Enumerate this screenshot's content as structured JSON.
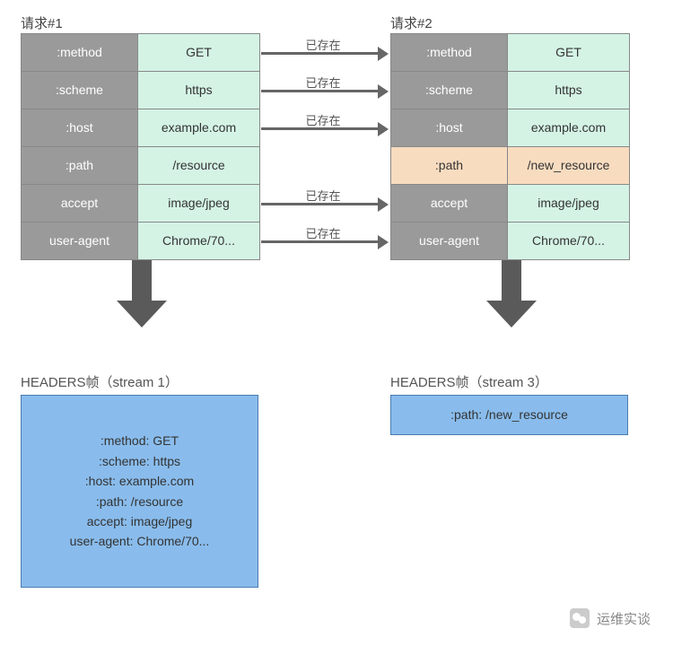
{
  "req1": {
    "title": "请求#1",
    "headers": [
      {
        "k": ":method",
        "v": "GET",
        "exists": true
      },
      {
        "k": ":scheme",
        "v": "https",
        "exists": true
      },
      {
        "k": ":host",
        "v": "example.com",
        "exists": true
      },
      {
        "k": ":path",
        "v": "/resource",
        "exists": false
      },
      {
        "k": "accept",
        "v": "image/jpeg",
        "exists": true
      },
      {
        "k": "user-agent",
        "v": "Chrome/70...",
        "exists": true
      }
    ]
  },
  "req2": {
    "title": "请求#2",
    "headers": [
      {
        "k": ":method",
        "v": "GET",
        "changed": false
      },
      {
        "k": ":scheme",
        "v": "https",
        "changed": false
      },
      {
        "k": ":host",
        "v": "example.com",
        "changed": false
      },
      {
        "k": ":path",
        "v": "/new_resource",
        "changed": true
      },
      {
        "k": "accept",
        "v": "image/jpeg",
        "changed": false
      },
      {
        "k": "user-agent",
        "v": "Chrome/70...",
        "changed": false
      }
    ]
  },
  "arrow_label": "已存在",
  "frame1": {
    "title": "HEADERS帧（stream 1）",
    "lines": [
      ":method: GET",
      ":scheme: https",
      ":host: example.com",
      ":path: /resource",
      "accept: image/jpeg",
      "user-agent: Chrome/70..."
    ]
  },
  "frame2": {
    "title": "HEADERS帧（stream 3）",
    "lines": [
      ":path: /new_resource"
    ]
  },
  "watermark": "运维实谈"
}
